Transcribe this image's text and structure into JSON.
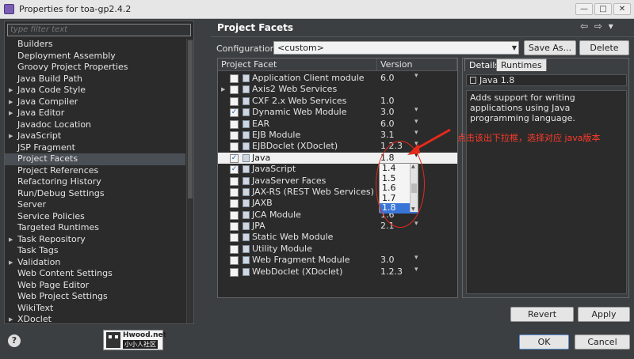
{
  "window": {
    "title": "Properties for toa-gp2.4.2",
    "minimize": "—",
    "maximize": "□",
    "close": "✕"
  },
  "filter": {
    "placeholder": "type filter text"
  },
  "tree": {
    "items": [
      {
        "label": "Builders",
        "expandable": false,
        "selected": false
      },
      {
        "label": "Deployment Assembly",
        "expandable": false,
        "selected": false
      },
      {
        "label": "Groovy Project Properties",
        "expandable": false,
        "selected": false
      },
      {
        "label": "Java Build Path",
        "expandable": false,
        "selected": false
      },
      {
        "label": "Java Code Style",
        "expandable": true,
        "selected": false
      },
      {
        "label": "Java Compiler",
        "expandable": true,
        "selected": false
      },
      {
        "label": "Java Editor",
        "expandable": true,
        "selected": false
      },
      {
        "label": "Javadoc Location",
        "expandable": false,
        "selected": false
      },
      {
        "label": "JavaScript",
        "expandable": true,
        "selected": false
      },
      {
        "label": "JSP Fragment",
        "expandable": false,
        "selected": false
      },
      {
        "label": "Project Facets",
        "expandable": false,
        "selected": true
      },
      {
        "label": "Project References",
        "expandable": false,
        "selected": false
      },
      {
        "label": "Refactoring History",
        "expandable": false,
        "selected": false
      },
      {
        "label": "Run/Debug Settings",
        "expandable": false,
        "selected": false
      },
      {
        "label": "Server",
        "expandable": false,
        "selected": false
      },
      {
        "label": "Service Policies",
        "expandable": false,
        "selected": false
      },
      {
        "label": "Targeted Runtimes",
        "expandable": false,
        "selected": false
      },
      {
        "label": "Task Repository",
        "expandable": true,
        "selected": false
      },
      {
        "label": "Task Tags",
        "expandable": false,
        "selected": false
      },
      {
        "label": "Validation",
        "expandable": true,
        "selected": false
      },
      {
        "label": "Web Content Settings",
        "expandable": false,
        "selected": false
      },
      {
        "label": "Web Page Editor",
        "expandable": false,
        "selected": false
      },
      {
        "label": "Web Project Settings",
        "expandable": false,
        "selected": false
      },
      {
        "label": "WikiText",
        "expandable": false,
        "selected": false
      },
      {
        "label": "XDoclet",
        "expandable": true,
        "selected": false
      }
    ]
  },
  "page": {
    "title": "Project Facets",
    "back": "⇦",
    "forward": "⇨",
    "menu": "▾"
  },
  "configuration": {
    "label": "Configuration:",
    "value": "<custom>",
    "save_as": "Save As...",
    "delete": "Delete"
  },
  "facets": {
    "col_facet": "Project Facet",
    "col_version": "Version",
    "rows": [
      {
        "name": "Application Client module",
        "version": "6.0",
        "checked": false,
        "expandable": false,
        "dropdown": true,
        "highlight": false
      },
      {
        "name": "Axis2 Web Services",
        "version": "",
        "checked": false,
        "expandable": true,
        "dropdown": false,
        "highlight": false
      },
      {
        "name": "CXF 2.x Web Services",
        "version": "1.0",
        "checked": false,
        "expandable": false,
        "dropdown": false,
        "highlight": false
      },
      {
        "name": "Dynamic Web Module",
        "version": "3.0",
        "checked": true,
        "expandable": false,
        "dropdown": true,
        "highlight": false
      },
      {
        "name": "EAR",
        "version": "6.0",
        "checked": false,
        "expandable": false,
        "dropdown": true,
        "highlight": false
      },
      {
        "name": "EJB Module",
        "version": "3.1",
        "checked": false,
        "expandable": false,
        "dropdown": true,
        "highlight": false
      },
      {
        "name": "EJBDoclet (XDoclet)",
        "version": "1.2.3",
        "checked": false,
        "expandable": false,
        "dropdown": true,
        "highlight": false
      },
      {
        "name": "Java",
        "version": "1.8",
        "checked": true,
        "expandable": false,
        "dropdown": true,
        "highlight": true
      },
      {
        "name": "JavaScript",
        "version": "",
        "checked": true,
        "expandable": false,
        "dropdown": false,
        "highlight": false
      },
      {
        "name": "JavaServer Faces",
        "version": "",
        "checked": false,
        "expandable": false,
        "dropdown": false,
        "highlight": false
      },
      {
        "name": "JAX-RS (REST Web Services)",
        "version": "",
        "checked": false,
        "expandable": false,
        "dropdown": false,
        "highlight": false
      },
      {
        "name": "JAXB",
        "version": "",
        "checked": false,
        "expandable": false,
        "dropdown": false,
        "highlight": false
      },
      {
        "name": "JCA Module",
        "version": "1.6",
        "checked": false,
        "expandable": false,
        "dropdown": false,
        "highlight": false
      },
      {
        "name": "JPA",
        "version": "2.1",
        "checked": false,
        "expandable": false,
        "dropdown": true,
        "highlight": false
      },
      {
        "name": "Static Web Module",
        "version": "",
        "checked": false,
        "expandable": false,
        "dropdown": false,
        "highlight": false
      },
      {
        "name": "Utility Module",
        "version": "",
        "checked": false,
        "expandable": false,
        "dropdown": false,
        "highlight": false
      },
      {
        "name": "Web Fragment Module",
        "version": "3.0",
        "checked": false,
        "expandable": false,
        "dropdown": true,
        "highlight": false
      },
      {
        "name": "WebDoclet (XDoclet)",
        "version": "1.2.3",
        "checked": false,
        "expandable": false,
        "dropdown": true,
        "highlight": false
      }
    ],
    "version_options": [
      "1.4",
      "1.5",
      "1.6",
      "1.7",
      "1.8"
    ],
    "version_selected": "1.8"
  },
  "details": {
    "tab_details": "Details",
    "tab_runtimes": "Runtimes",
    "title": "Java 1.8",
    "description": "Adds support for writing applications using Java programming language."
  },
  "annotation": {
    "text": "点击该出下拉框，选择对应 java版本",
    "color": "#ff3a2a"
  },
  "watermark": {
    "line1": "Hwood.net",
    "line2": "小小人社区"
  },
  "footer": {
    "help": "?",
    "revert": "Revert",
    "apply": "Apply",
    "ok": "OK",
    "cancel": "Cancel"
  }
}
